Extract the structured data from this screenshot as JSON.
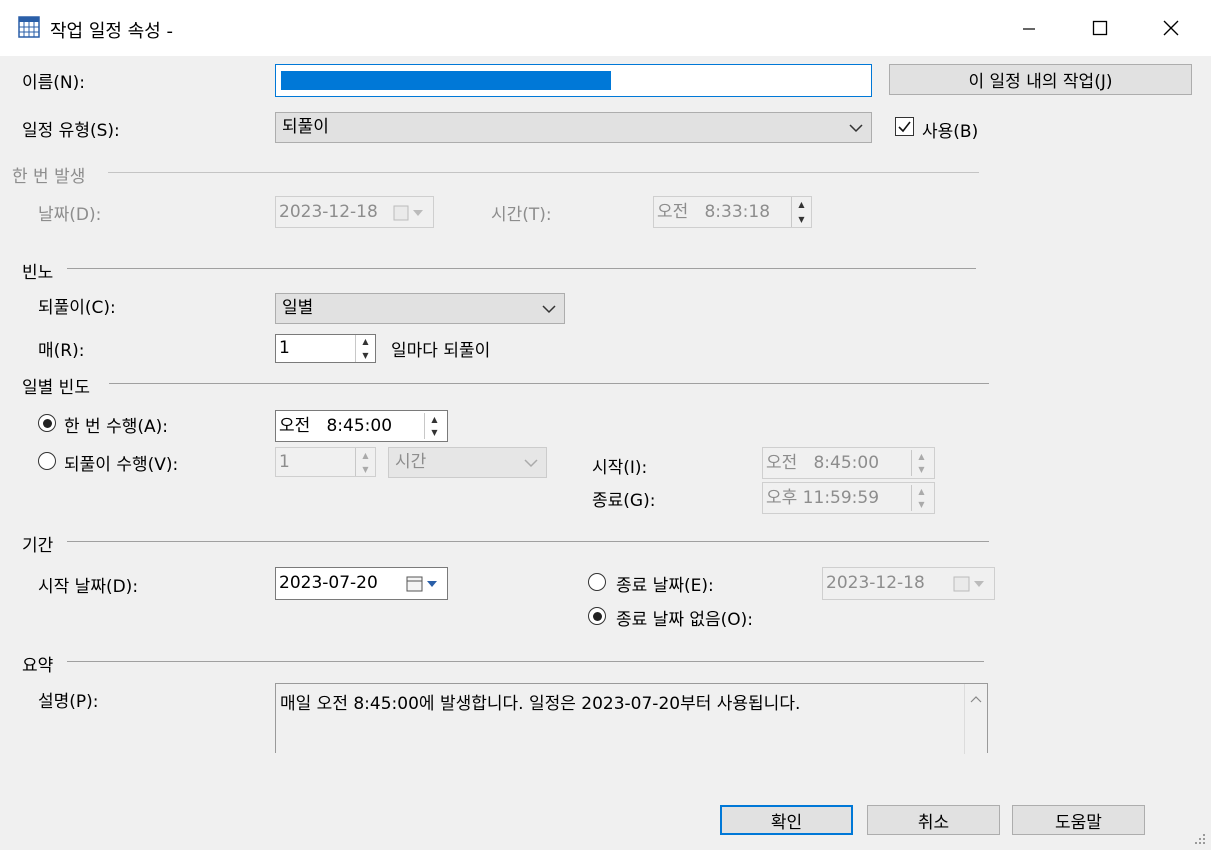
{
  "window": {
    "title": "작업 일정 속성 -",
    "icon": "calendar-grid-icon",
    "controls": {
      "minimize": "minimize-icon",
      "maximize": "maximize-icon",
      "close": "close-icon"
    }
  },
  "name": {
    "label": "이름(N):",
    "value": ""
  },
  "jobs_button": "이 일정 내의 작업(J)",
  "schedule_type": {
    "label": "일정 유형(S):",
    "value": "되풀이"
  },
  "enabled": {
    "label": "사용(B)",
    "checked": true
  },
  "one_time": {
    "section": "한 번 발생",
    "date_label": "날짜(D):",
    "date_value": "2023-12-18",
    "time_label": "시간(T):",
    "time_value": "오전   8:33:18"
  },
  "frequency": {
    "section": "빈노",
    "occurs_label": "되풀이(C):",
    "occurs_value": "일별",
    "every_label": "매(R):",
    "every_value": "1",
    "every_suffix": "일마다 되풀이"
  },
  "daily": {
    "section": "일별 빈도",
    "once_label": "한 번 수행(A):",
    "once_time": "오전   8:45:00",
    "once_selected": true,
    "recur_label": "되풀이 수행(V):",
    "recur_value": "1",
    "recur_unit": "시간",
    "start_label": "시작(I):",
    "start_value": "오전   8:45:00",
    "end_label": "종료(G):",
    "end_value": "오후 11:59:59"
  },
  "duration": {
    "section": "기간",
    "start_label": "시작 날짜(D):",
    "start_value": "2023-07-20",
    "end_date_label": "종료 날짜(E):",
    "end_date_value": "2023-12-18",
    "no_end_label": "종료 날짜 없음(O):",
    "no_end_selected": true
  },
  "summary": {
    "section": "요약",
    "desc_label": "설명(P):",
    "desc_value": "매일 오전 8:45:00에 발생합니다. 일정은 2023-07-20부터 사용됩니다."
  },
  "buttons": {
    "ok": "확인",
    "cancel": "취소",
    "help": "도움말"
  },
  "colors": {
    "selection": "#0078d7",
    "accent": "#0078d7",
    "dialog_bg": "#f0f0f0"
  }
}
